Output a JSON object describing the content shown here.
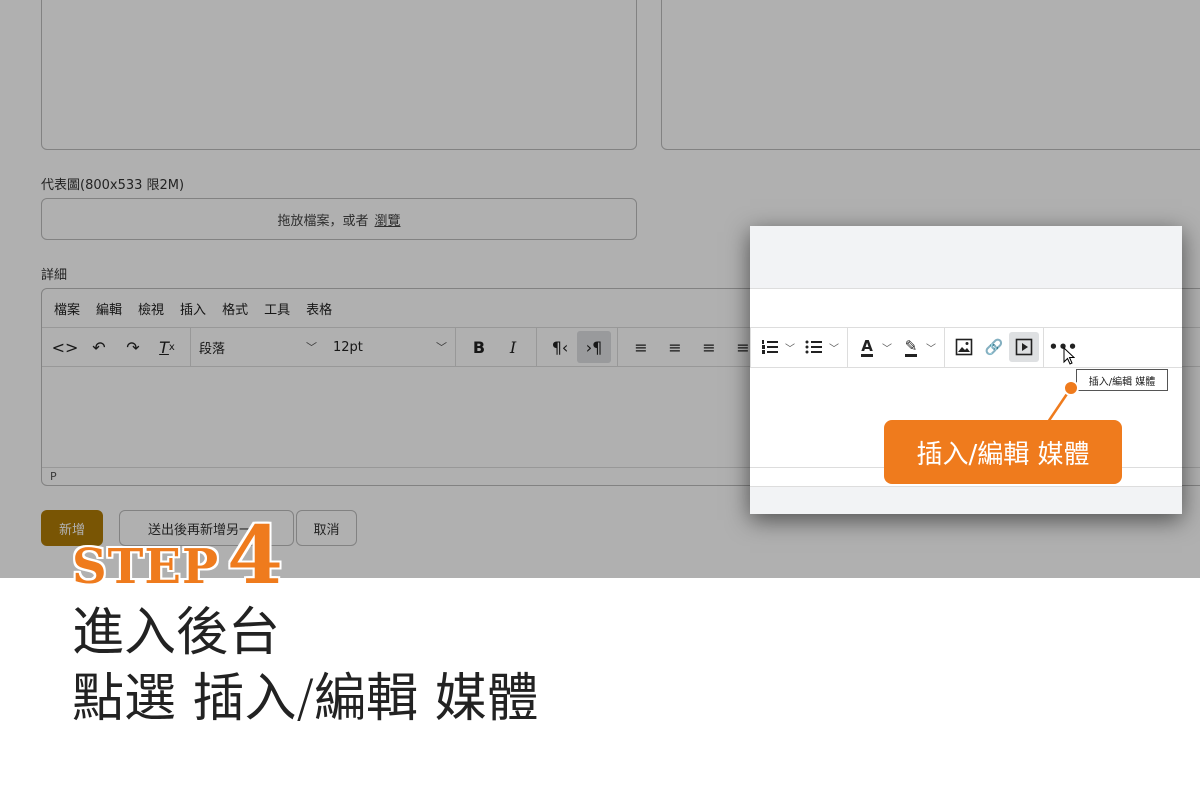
{
  "form": {
    "image_label": "代表圖(800x533 限2M)",
    "dropzone_text": "拖放檔案，或者",
    "dropzone_browse": "瀏覽",
    "details_label": "詳細"
  },
  "editor": {
    "menu": [
      "檔案",
      "編輯",
      "檢視",
      "插入",
      "格式",
      "工具",
      "表格"
    ],
    "block_format": "段落",
    "font_size": "12pt",
    "status_path": "P"
  },
  "buttons": {
    "add": "新增",
    "save_and_add_another": "送出後再新增另一個",
    "cancel": "取消"
  },
  "zoom": {
    "tooltip": "插入/編輯 媒體",
    "callout": "插入/編輯 媒體",
    "colors": {
      "accent": "#ef7b1d"
    }
  },
  "step": {
    "word": "STEP",
    "number": "4"
  },
  "caption": {
    "line1": "進入後台",
    "line2": "點選 插入/編輯 媒體"
  }
}
